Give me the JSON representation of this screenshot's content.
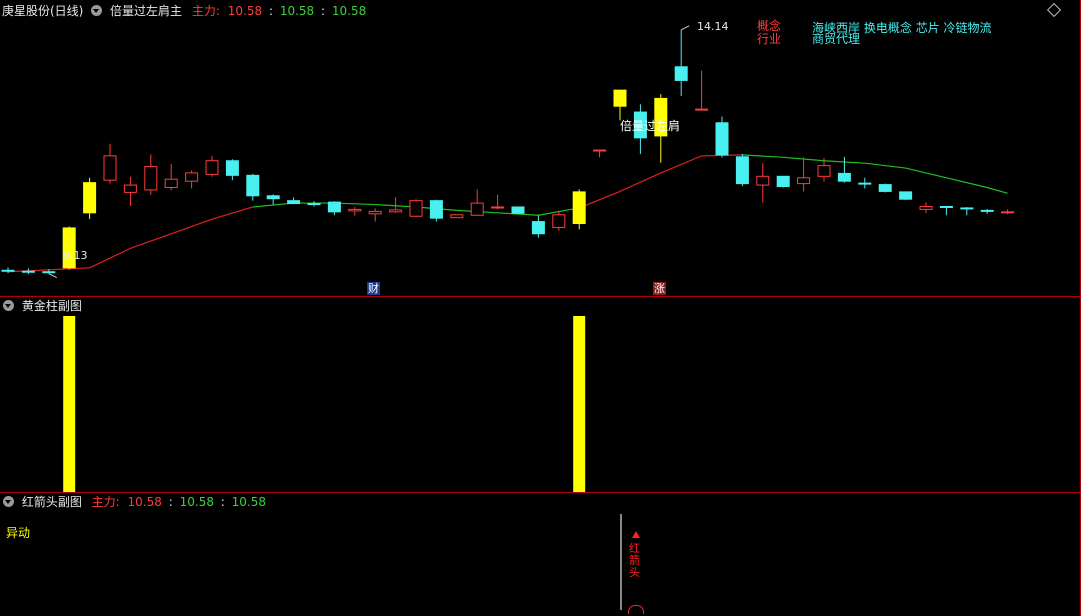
{
  "main_header": {
    "stock": "庚星股份(日线)",
    "indicator": "倍量过左肩主",
    "zl_label": "主力:",
    "v1": "10.58",
    "v2": "10.58",
    "v3": "10.58"
  },
  "concepts": {
    "label1": "概念",
    "label2": "行业",
    "items1": [
      "海峡西岸",
      "换电概念",
      "芯片",
      "冷链物流"
    ],
    "items2": [
      "商贸代理"
    ]
  },
  "main_annotations": {
    "high": "14.14",
    "low": "9.13",
    "signal": "倍量过左肩",
    "tag_cai": "财",
    "tag_zhang": "涨"
  },
  "sub1_header": {
    "title": "黄金柱副图"
  },
  "sub2_header": {
    "title": "红箭头副图",
    "zl_label": "主力:",
    "v1": "10.58",
    "v2": "10.58",
    "v3": "10.58",
    "yidong": "异动",
    "arrow_label": "红箭头"
  },
  "colors": {
    "up": "#ff3c3c",
    "down": "#48f0f0",
    "gold": "#ffff00",
    "ma_red": "#e02020",
    "ma_green": "#20c020"
  },
  "chart_data": {
    "type": "candlestick",
    "price_range": [
      9.0,
      14.3
    ],
    "candles": [
      {
        "o": 9.2,
        "h": 9.26,
        "l": 9.14,
        "c": 9.18
      },
      {
        "o": 9.18,
        "h": 9.24,
        "l": 9.12,
        "c": 9.17
      },
      {
        "o": 9.17,
        "h": 9.22,
        "l": 9.13,
        "c": 9.15
      },
      {
        "o": 9.25,
        "h": 10.1,
        "l": 9.22,
        "c": 10.07,
        "gold": true
      },
      {
        "o": 10.38,
        "h": 11.1,
        "l": 10.25,
        "c": 11.0,
        "gold": true
      },
      {
        "o": 11.05,
        "h": 11.8,
        "l": 10.98,
        "c": 11.55
      },
      {
        "o": 10.8,
        "h": 11.12,
        "l": 10.52,
        "c": 10.95
      },
      {
        "o": 10.85,
        "h": 11.58,
        "l": 10.75,
        "c": 11.33
      },
      {
        "o": 10.9,
        "h": 11.38,
        "l": 10.84,
        "c": 11.07
      },
      {
        "o": 11.03,
        "h": 11.25,
        "l": 10.88,
        "c": 11.2
      },
      {
        "o": 11.17,
        "h": 11.55,
        "l": 11.12,
        "c": 11.45
      },
      {
        "o": 11.45,
        "h": 11.48,
        "l": 11.05,
        "c": 11.15
      },
      {
        "o": 11.15,
        "h": 11.18,
        "l": 10.63,
        "c": 10.73
      },
      {
        "o": 10.73,
        "h": 10.76,
        "l": 10.55,
        "c": 10.67
      },
      {
        "o": 10.63,
        "h": 10.7,
        "l": 10.56,
        "c": 10.57
      },
      {
        "o": 10.57,
        "h": 10.62,
        "l": 10.51,
        "c": 10.55
      },
      {
        "o": 10.6,
        "h": 10.62,
        "l": 10.33,
        "c": 10.4
      },
      {
        "o": 10.42,
        "h": 10.5,
        "l": 10.32,
        "c": 10.45
      },
      {
        "o": 10.36,
        "h": 10.47,
        "l": 10.2,
        "c": 10.41
      },
      {
        "o": 10.4,
        "h": 10.7,
        "l": 10.38,
        "c": 10.44
      },
      {
        "o": 10.31,
        "h": 10.66,
        "l": 10.3,
        "c": 10.63
      },
      {
        "o": 10.63,
        "h": 10.65,
        "l": 10.2,
        "c": 10.27
      },
      {
        "o": 10.28,
        "h": 10.34,
        "l": 10.28,
        "c": 10.34
      },
      {
        "o": 10.33,
        "h": 10.86,
        "l": 10.31,
        "c": 10.58
      },
      {
        "o": 10.5,
        "h": 10.75,
        "l": 10.45,
        "c": 10.5
      },
      {
        "o": 10.5,
        "h": 10.51,
        "l": 10.35,
        "c": 10.37
      },
      {
        "o": 10.2,
        "h": 10.33,
        "l": 9.87,
        "c": 9.95
      },
      {
        "o": 10.08,
        "h": 10.41,
        "l": 10.01,
        "c": 10.34
      },
      {
        "o": 10.16,
        "h": 10.86,
        "l": 10.04,
        "c": 10.81,
        "gold": true
      },
      {
        "o": 11.65,
        "h": 11.68,
        "l": 11.52,
        "c": 11.67
      },
      {
        "o": 12.57,
        "h": 12.9,
        "l": 12.28,
        "c": 12.9,
        "gold": true
      },
      {
        "o": 12.45,
        "h": 12.61,
        "l": 11.59,
        "c": 11.92
      },
      {
        "o": 11.96,
        "h": 12.82,
        "l": 11.41,
        "c": 12.73,
        "gold": true
      },
      {
        "o": 13.38,
        "h": 14.14,
        "l": 12.78,
        "c": 13.1
      },
      {
        "o": 12.51,
        "h": 13.3,
        "l": 12.51,
        "c": 12.51
      },
      {
        "o": 12.23,
        "h": 12.36,
        "l": 11.52,
        "c": 11.57
      },
      {
        "o": 11.53,
        "h": 11.59,
        "l": 10.93,
        "c": 10.98
      },
      {
        "o": 10.95,
        "h": 11.4,
        "l": 10.59,
        "c": 11.13
      },
      {
        "o": 11.13,
        "h": 11.13,
        "l": 10.9,
        "c": 10.92
      },
      {
        "o": 10.98,
        "h": 11.52,
        "l": 10.82,
        "c": 11.1
      },
      {
        "o": 11.13,
        "h": 11.51,
        "l": 11.02,
        "c": 11.35
      },
      {
        "o": 11.19,
        "h": 11.53,
        "l": 11.0,
        "c": 11.03
      },
      {
        "o": 10.99,
        "h": 11.1,
        "l": 10.88,
        "c": 10.98
      },
      {
        "o": 10.96,
        "h": 10.98,
        "l": 10.8,
        "c": 10.82
      },
      {
        "o": 10.81,
        "h": 10.82,
        "l": 10.64,
        "c": 10.66
      },
      {
        "o": 10.45,
        "h": 10.6,
        "l": 10.37,
        "c": 10.51
      },
      {
        "o": 10.51,
        "h": 10.52,
        "l": 10.33,
        "c": 10.49
      },
      {
        "o": 10.48,
        "h": 10.5,
        "l": 10.33,
        "c": 10.46
      },
      {
        "o": 10.43,
        "h": 10.46,
        "l": 10.36,
        "c": 10.42
      },
      {
        "o": 10.4,
        "h": 10.45,
        "l": 10.35,
        "c": 10.4
      }
    ],
    "ma": [
      {
        "i": 0,
        "v": 9.17
      },
      {
        "i": 4,
        "v": 9.25
      },
      {
        "i": 6,
        "v": 9.65
      },
      {
        "i": 8,
        "v": 9.95
      },
      {
        "i": 10,
        "v": 10.25
      },
      {
        "i": 12,
        "v": 10.5
      },
      {
        "i": 14,
        "v": 10.58
      },
      {
        "i": 16,
        "v": 10.58
      },
      {
        "i": 18,
        "v": 10.55
      },
      {
        "i": 20,
        "v": 10.5
      },
      {
        "i": 22,
        "v": 10.43
      },
      {
        "i": 24,
        "v": 10.38
      },
      {
        "i": 26,
        "v": 10.33
      },
      {
        "i": 28,
        "v": 10.48
      },
      {
        "i": 30,
        "v": 10.82
      },
      {
        "i": 32,
        "v": 11.2
      },
      {
        "i": 34,
        "v": 11.55
      },
      {
        "i": 36,
        "v": 11.57
      },
      {
        "i": 38,
        "v": 11.52
      },
      {
        "i": 40,
        "v": 11.45
      },
      {
        "i": 42,
        "v": 11.4
      },
      {
        "i": 44,
        "v": 11.3
      },
      {
        "i": 46,
        "v": 11.1
      },
      {
        "i": 48,
        "v": 10.9
      },
      {
        "i": 49,
        "v": 10.78
      }
    ],
    "ma_green_from": 12,
    "ma_green_to": 27,
    "ma_green_from2": 36
  }
}
